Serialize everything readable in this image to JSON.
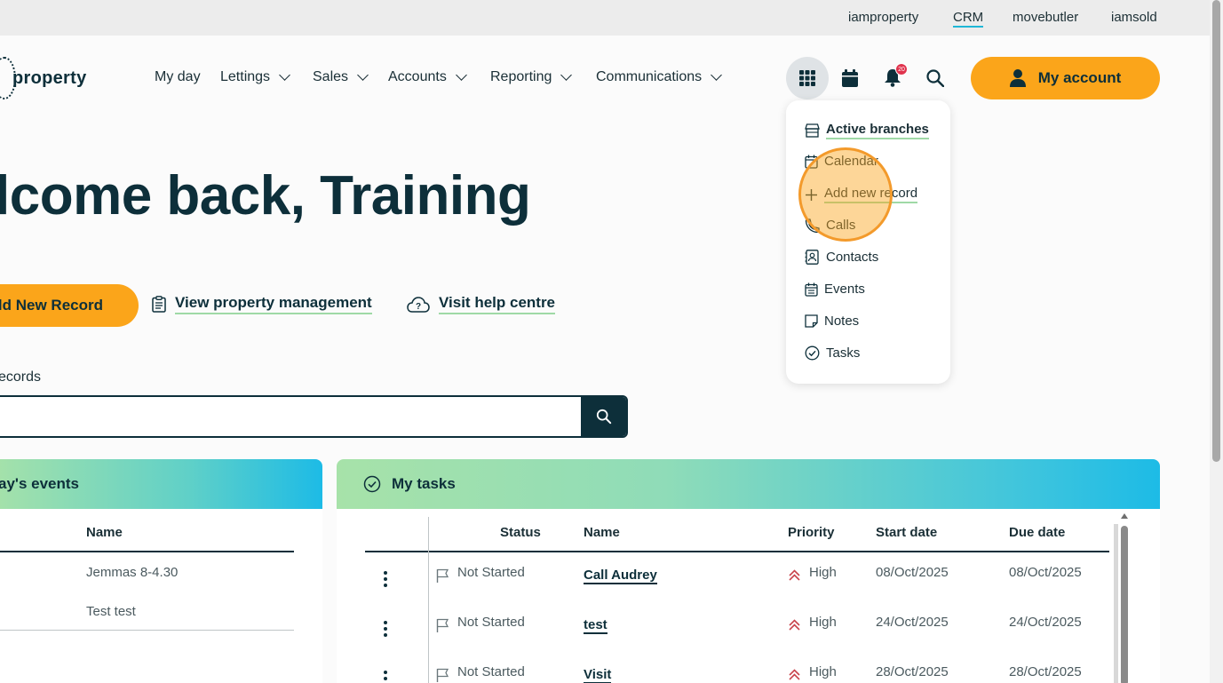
{
  "topbar": {
    "links": [
      "iamproperty",
      "CRM",
      "movebutler",
      "iamsold"
    ],
    "active": "CRM"
  },
  "header": {
    "logo_text": "property",
    "nav": [
      "My day",
      "Lettings",
      "Sales",
      "Accounts",
      "Reporting",
      "Communications"
    ],
    "notification_count": "20",
    "account_label": "My account"
  },
  "main": {
    "welcome": "lcome back, Training",
    "add_record_label": "ld New Record",
    "view_pm_label": "View property management",
    "help_label": "Visit help centre",
    "search_label": "ecords"
  },
  "events_panel": {
    "title": "ay's events",
    "column": "Name",
    "rows": [
      "Jemmas 8-4.30",
      "Test test"
    ]
  },
  "tasks_panel": {
    "title": "My tasks",
    "columns": [
      "Status",
      "Name",
      "Priority",
      "Start date",
      "Due date"
    ],
    "rows": [
      {
        "status": "Not Started",
        "name": "Call Audrey",
        "priority": "High",
        "start": "08/Oct/2025",
        "due": "08/Oct/2025"
      },
      {
        "status": "Not Started",
        "name": "test",
        "priority": "High",
        "start": "24/Oct/2025",
        "due": "24/Oct/2025"
      },
      {
        "status": "Not Started",
        "name": "Visit",
        "priority": "High",
        "start": "28/Oct/2025",
        "due": "28/Oct/2025"
      }
    ]
  },
  "dropdown": {
    "items": [
      "Active branches",
      "Calendar",
      "Add new record",
      "Calls",
      "Contacts",
      "Events",
      "Notes",
      "Tasks"
    ]
  },
  "colors": {
    "primary": "#0d2f3a",
    "accent": "#fba51a",
    "link_underline": "#9fd9a6"
  }
}
